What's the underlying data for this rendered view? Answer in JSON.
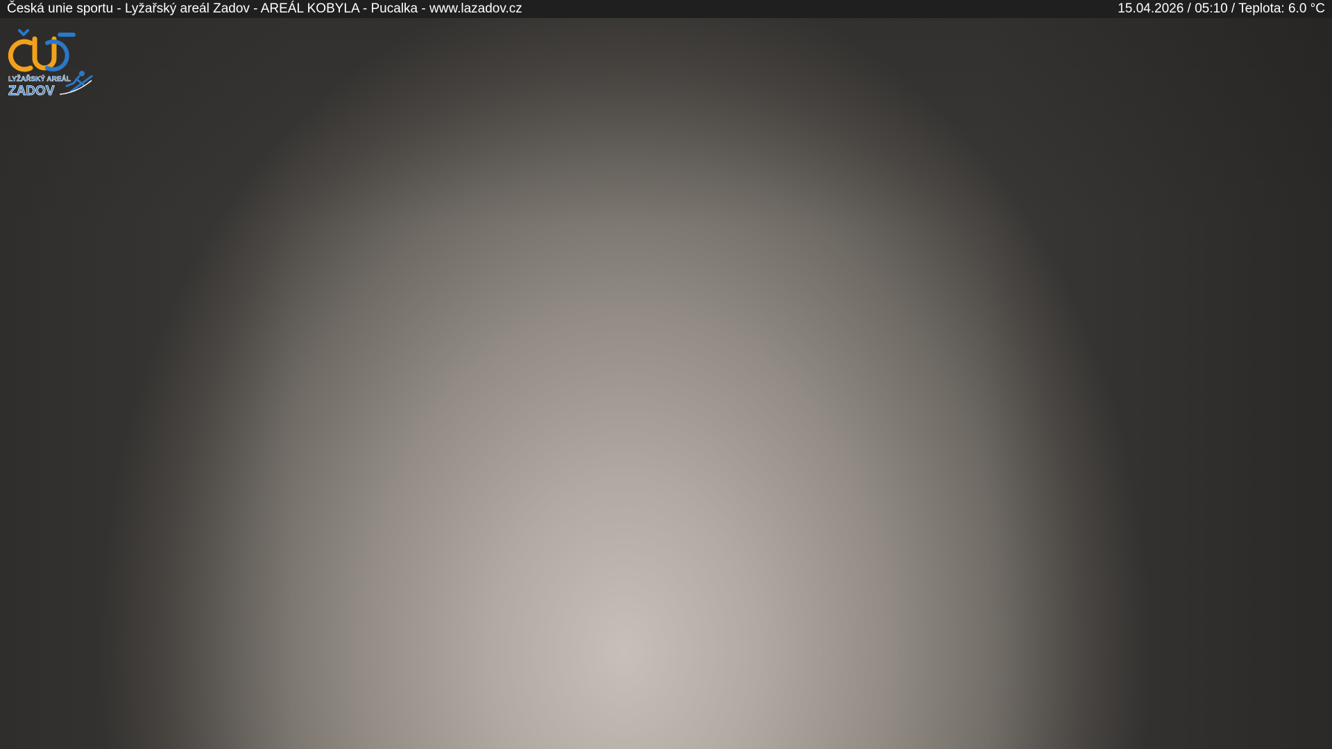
{
  "overlay": {
    "caption": "Česká unie sportu - Lyžařský areál Zadov - AREÁL KOBYLA - Pucalka - www.lazadov.cz",
    "date": "15.04.2026",
    "time": "05:10",
    "temperature_label": "Teplota:",
    "temperature_value": "6.0 °C"
  },
  "logo": {
    "mark": "ČUS",
    "line1": "LYŽAŘSKÝ AREÁL",
    "line2": "ZADOV"
  },
  "colors": {
    "bar_background": "#1f1f1f",
    "bar_text": "#ffffff",
    "logo_orange": "#f2a21a",
    "logo_blue": "#2a78c8"
  }
}
